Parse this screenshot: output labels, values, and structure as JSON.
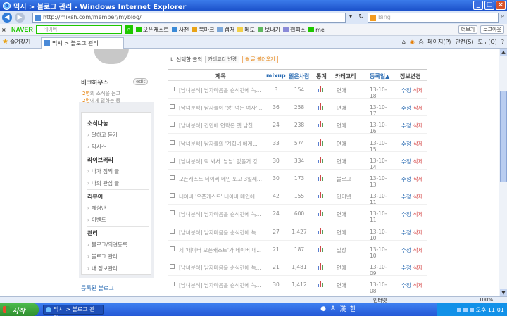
{
  "window": {
    "title": "믹시 > 블로그 관리 - Windows Internet Explorer"
  },
  "address": {
    "url": "http://mixsh.com/member/myblog/",
    "search_placeholder": "Bing"
  },
  "naver_bar": {
    "logo": "NAVER",
    "search_placeholder": "네이버",
    "items": [
      "오픈캐스트",
      "사전",
      "북마크",
      "캡처",
      "메모",
      "보내기",
      "웹피스",
      "me"
    ],
    "right": [
      "더보기",
      "로그아웃"
    ]
  },
  "tabs": {
    "favorites": "즐겨찾기",
    "active_tab": "믹시 > 블로그 관리",
    "tools": [
      "페이지(P)",
      "안전(S)",
      "도구(O)"
    ]
  },
  "sidebar": {
    "blog_name": "비크하우스",
    "edit_label": "edit",
    "stats": [
      {
        "count": "2명",
        "text": "의 소식을 듣고"
      },
      {
        "count": "2명",
        "text": "에게 말하는 중"
      }
    ],
    "sections": [
      {
        "title": "소식나눔",
        "items": [
          "말하고 듣기",
          "믹시스"
        ]
      },
      {
        "title": "라이브러리",
        "items": [
          "나가 점찍 글",
          "나의 관심 글"
        ]
      },
      {
        "title": "리뷰어",
        "items": [
          "체험단",
          "이벤트"
        ]
      },
      {
        "title": "관리",
        "items": [
          "블로그/의견등록",
          "블로그 관리",
          "내 정보관리"
        ]
      }
    ],
    "linked_blogs": "등록된 블로그"
  },
  "main": {
    "options": {
      "selected_label": "선택한 글의",
      "category_change": "카테고리 변경",
      "fetch_posts": "글 불러오기"
    },
    "headers": {
      "title": "제목",
      "mixup": "mixup",
      "read": "읽은사람",
      "stats": "통계",
      "category": "카테고리",
      "date": "등록일▲",
      "info": "정보변경"
    },
    "edit_label": "수정",
    "delete_label": "삭제",
    "rows": [
      {
        "title": "[남녀분석] 남자마음을 순식간에 녹...",
        "mixup": "3",
        "read": "154",
        "category": "연애",
        "date": "13-10-18"
      },
      {
        "title": "[남녀분석] 남자들이 '꽝' 먹는 여자'...",
        "mixup": "36",
        "read": "258",
        "category": "연애",
        "date": "13-10-17"
      },
      {
        "title": "[남녀분석] 간만에 연락온 옛 남친...",
        "mixup": "24",
        "read": "238",
        "category": "연애",
        "date": "13-10-16"
      },
      {
        "title": "[남녀분석] 남자들의 '계획녀'에게...",
        "mixup": "33",
        "read": "574",
        "category": "연애",
        "date": "13-10-15"
      },
      {
        "title": "[남녀분석] 딱 봐서 '남남' 없을거 같...",
        "mixup": "30",
        "read": "334",
        "category": "연애",
        "date": "13-10-14"
      },
      {
        "title": "오픈캐스트 네이버 메인 또고 3일째...",
        "mixup": "30",
        "read": "173",
        "category": "블로그",
        "date": "13-10-13"
      },
      {
        "title": "네이버 '오픈캐스트' 네이버 메인에...",
        "mixup": "42",
        "read": "155",
        "category": "인터넷",
        "date": "13-10-11"
      },
      {
        "title": "[남녀분석] 남자마음을 순식간에 녹...",
        "mixup": "24",
        "read": "600",
        "category": "연애",
        "date": "13-10-11"
      },
      {
        "title": "[남녀분석] 남자마음을 순식간에 녹...",
        "mixup": "27",
        "read": "1,427",
        "category": "연애",
        "date": "13-10-10"
      },
      {
        "title": "제 '네이버 오픈캐스트'가 네이버 메...",
        "mixup": "21",
        "read": "187",
        "category": "일상",
        "date": "13-10-10"
      },
      {
        "title": "[남녀분석] 남자마음을 순식간에 녹...",
        "mixup": "21",
        "read": "1,481",
        "category": "연애",
        "date": "13-10-09"
      },
      {
        "title": "[남녀분석] 남자마음을 순식간에 녹...",
        "mixup": "30",
        "read": "1,412",
        "category": "연애",
        "date": "13-10-08"
      }
    ]
  },
  "statusbar": {
    "zone": "인터넷",
    "zoom": "100%"
  },
  "taskbar": {
    "start": "시작",
    "task": "믹시 > 블로그 관리...",
    "ime": [
      "A",
      "漢",
      "한"
    ],
    "clock": "오후 11:01"
  },
  "colors": {
    "accent": "#2b6cb3",
    "delete": "#d23c3c",
    "naver": "#1ec800",
    "orange": "#e57c00"
  }
}
